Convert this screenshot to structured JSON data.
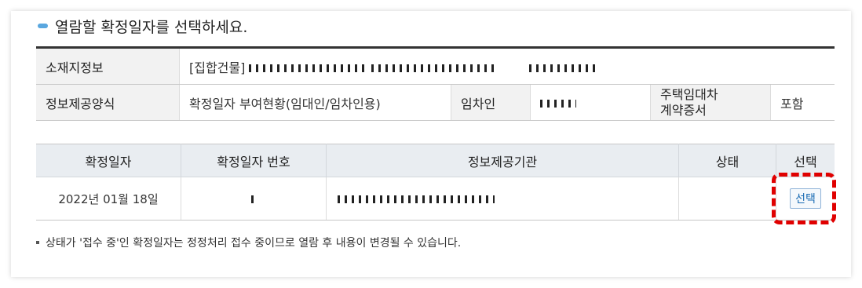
{
  "heading": "열람할 확정일자를 선택하세요.",
  "info": {
    "location_label": "소재지정보",
    "location_value": "[집합건물]",
    "method_label": "정보제공양식",
    "method_value": "확정일자 부여현황(임대인/임차인용)",
    "tenant_label": "임차인",
    "contract_label_1": "주택임대차",
    "contract_label_2": "계약증서",
    "contract_value": "포함"
  },
  "table": {
    "headers": [
      "확정일자",
      "확정일자 번호",
      "정보제공기관",
      "상태",
      "선택"
    ],
    "rows": [
      {
        "date": "2022년 01월 18일",
        "number": "",
        "agency": "",
        "status": "",
        "select_label": "선택"
      }
    ]
  },
  "note": "상태가 '접수 중'인 확정일자는 정정처리 접수 중이므로 열람 후 내용이 변경될 수 있습니다.",
  "colors": {
    "accent": "#5aa7df",
    "highlight": "#e00000"
  }
}
